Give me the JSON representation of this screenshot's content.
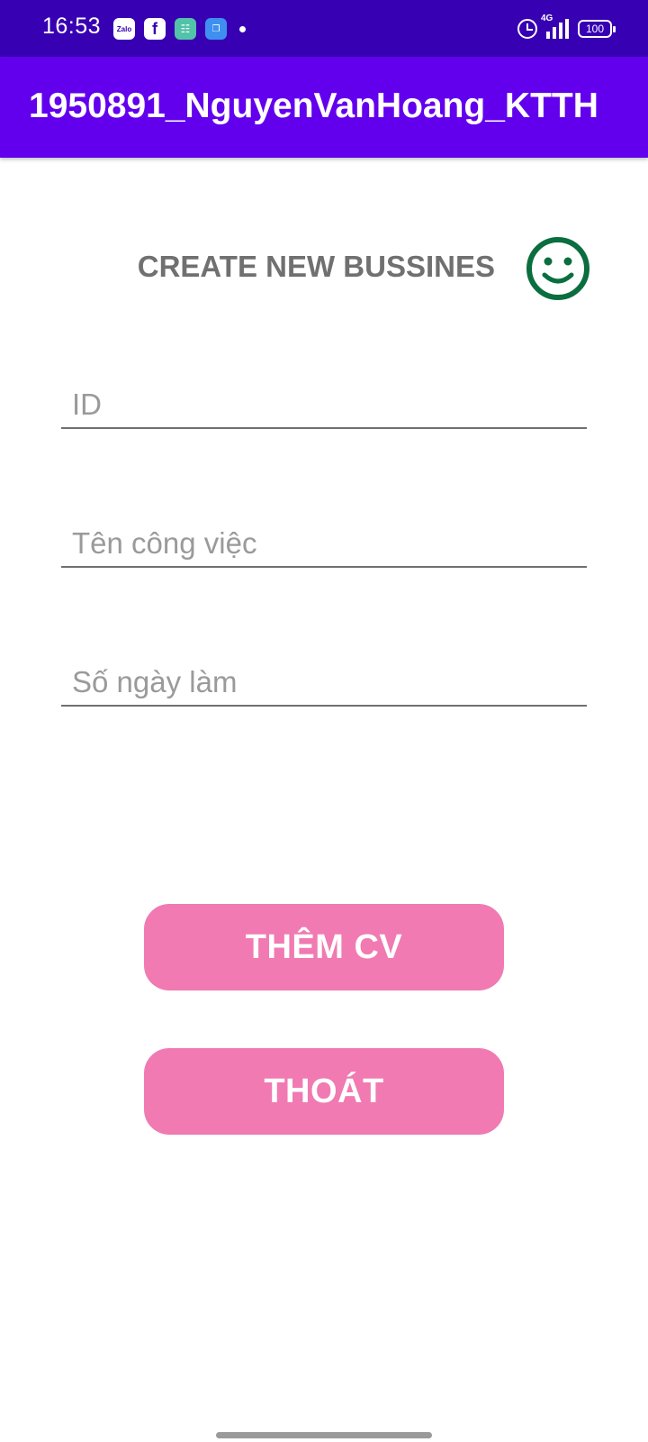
{
  "status_bar": {
    "time": "16:53",
    "notification_icons": [
      {
        "name": "zalo-icon",
        "glyph": "Zalo"
      },
      {
        "name": "facebook-icon",
        "glyph": "f"
      },
      {
        "name": "shopping-bag-icon",
        "glyph": "☷"
      },
      {
        "name": "app-icon",
        "glyph": "❐"
      }
    ],
    "network": "4G",
    "battery": "100"
  },
  "app_bar": {
    "title": "1950891_NguyenVanHoang_KTTH",
    "background": "#6200ee",
    "status_color": "#3700b3"
  },
  "form": {
    "header": "CREATE NEW BUSSINES",
    "header_icon": "smiley-icon",
    "header_icon_color": "#0a6e3f",
    "fields": {
      "id": {
        "placeholder": "ID",
        "value": ""
      },
      "job_name": {
        "placeholder": "Tên công việc",
        "value": ""
      },
      "work_days": {
        "placeholder": "Số ngày làm",
        "value": ""
      }
    },
    "buttons": {
      "add_label": "THÊM CV",
      "exit_label": "THOÁT",
      "color": "#f07ab1"
    }
  }
}
